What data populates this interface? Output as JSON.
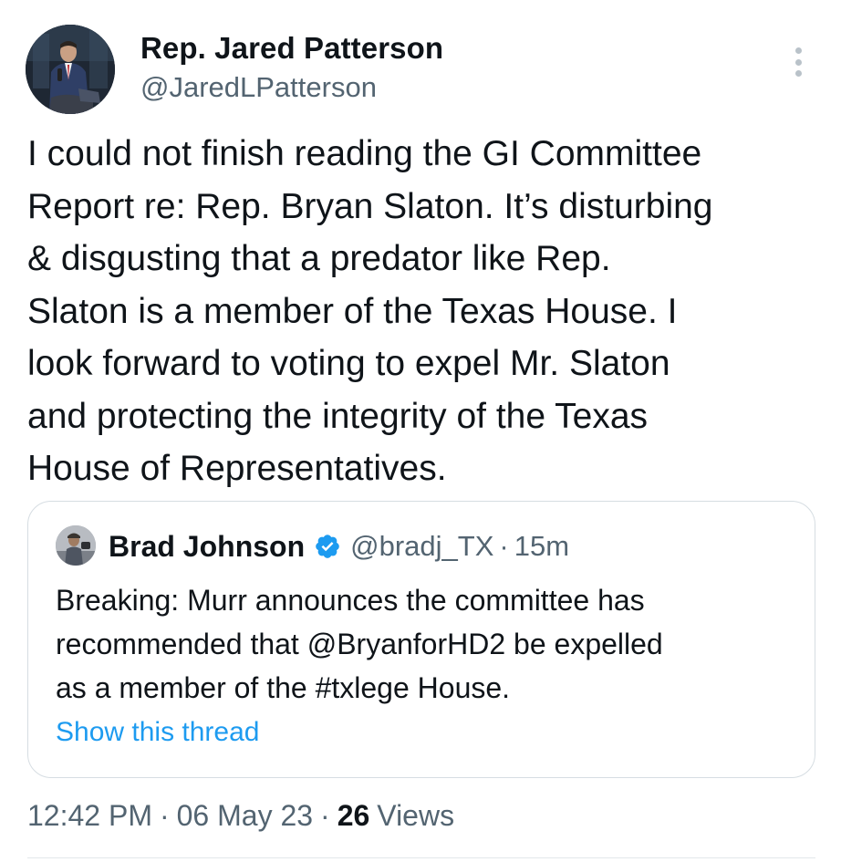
{
  "author": {
    "display_name": "Rep. Jared Patterson",
    "handle": "@JaredLPatterson",
    "avatar_icon": "profile-photo-man-suit-microphone"
  },
  "menu_icon": "more-vertical-icon",
  "tweet": {
    "lines": [
      "I could not finish reading the GI Committee",
      "Report re: Rep. Bryan Slaton. It’s disturbing",
      "& disgusting that a predator like Rep.",
      "Slaton is a member of the Texas House. I",
      "look forward to voting to expel Mr. Slaton",
      "and protecting the integrity of the Texas",
      "House of Representatives."
    ]
  },
  "quote": {
    "display_name": "Brad Johnson",
    "verified": true,
    "verified_color": "#1d9bf0",
    "handle": "@bradj_TX",
    "separator": "·",
    "time": "15m",
    "lines": [
      "Breaking: Murr announces the committee has",
      "recommended that @BryanforHD2 be expelled",
      "as a member of the #txlege House."
    ],
    "show_thread": "Show this thread",
    "link_color": "#1d9bf0"
  },
  "meta": {
    "time": "12:42 PM",
    "separator": "·",
    "date": "06 May 23",
    "views_count": "26",
    "views_label": "Views"
  }
}
